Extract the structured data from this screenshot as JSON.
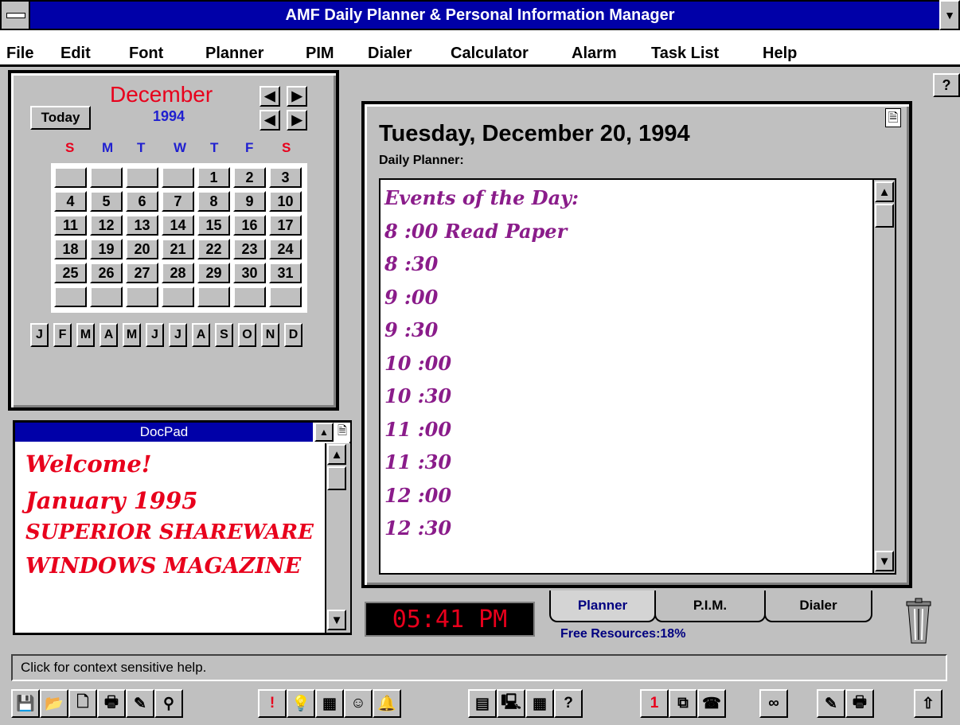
{
  "window": {
    "title": "AMF Daily Planner & Personal Information Manager"
  },
  "menu": [
    "File",
    "Edit",
    "Font",
    "Planner",
    "PIM",
    "Dialer",
    "Calculator",
    "Alarm",
    "Task List",
    "Help"
  ],
  "calendar": {
    "month": "December",
    "year": "1994",
    "today_label": "Today",
    "day_headers": [
      "S",
      "M",
      "T",
      "W",
      "T",
      "F",
      "S"
    ],
    "day_header_colors": [
      "#e8001c",
      "#2020d0",
      "#2020d0",
      "#2020d0",
      "#2020d0",
      "#2020d0",
      "#e8001c"
    ],
    "weeks": [
      [
        "",
        "",
        "",
        "",
        "1",
        "2",
        "3"
      ],
      [
        "4",
        "5",
        "6",
        "7",
        "8",
        "9",
        "10"
      ],
      [
        "11",
        "12",
        "13",
        "14",
        "15",
        "16",
        "17"
      ],
      [
        "18",
        "19",
        "20",
        "21",
        "22",
        "23",
        "24"
      ],
      [
        "25",
        "26",
        "27",
        "28",
        "29",
        "30",
        "31"
      ],
      [
        "",
        "",
        "",
        "",
        "",
        "",
        ""
      ]
    ],
    "month_buttons": [
      "J",
      "F",
      "M",
      "A",
      "M",
      "J",
      "J",
      "A",
      "S",
      "O",
      "N",
      "D"
    ]
  },
  "docpad": {
    "title": "DocPad",
    "lines": [
      "Welcome!",
      "January 1995",
      "SUPERIOR SHAREWARE",
      "WINDOWS MAGAZINE"
    ]
  },
  "planner": {
    "date_header": "Tuesday, December 20, 1994",
    "label": "Daily Planner:",
    "events": [
      "Events of the Day:",
      "8 :00 Read Paper",
      "8 :30",
      "9 :00",
      "9 :30",
      "10 :00",
      "10 :30",
      "11 :00",
      "11 :30",
      "12 :00",
      "12 :30"
    ]
  },
  "clock": "05:41 PM",
  "tabs": [
    "Planner",
    "P.I.M.",
    "Dialer"
  ],
  "free_resources": "Free Resources:18%",
  "status": "Click for context sensitive help.",
  "help_pointer": "?",
  "colors": {
    "title_bar": "#0000a8",
    "accent_red": "#e8001c",
    "event_purple": "#8a1c8a",
    "blue": "#2020d0"
  },
  "toolbar": [
    {
      "icon": "save-icon",
      "glyph": "💾"
    },
    {
      "icon": "open-folder-icon",
      "glyph": "📂"
    },
    {
      "icon": "new-document-icon",
      "glyph": "🗋"
    },
    {
      "icon": "print-icon",
      "glyph": "🖶"
    },
    {
      "icon": "edit-icon",
      "glyph": "✎"
    },
    {
      "icon": "search-icon",
      "glyph": "⚲"
    },
    {
      "icon": "alert-icon",
      "glyph": "!"
    },
    {
      "icon": "lightbulb-icon",
      "glyph": "💡"
    },
    {
      "icon": "calendar-icon",
      "glyph": "▦"
    },
    {
      "icon": "people-icon",
      "glyph": "☺"
    },
    {
      "icon": "alarm-bell-icon",
      "glyph": "🔔"
    },
    {
      "icon": "notepad-icon",
      "glyph": "▤"
    },
    {
      "icon": "computer-icon",
      "glyph": "🖳"
    },
    {
      "icon": "calculator-icon",
      "glyph": "▦"
    },
    {
      "icon": "question-icon",
      "glyph": "?"
    },
    {
      "icon": "daily-calendar-icon",
      "glyph": "1"
    },
    {
      "icon": "windows-icon",
      "glyph": "⧉"
    },
    {
      "icon": "phone-icon",
      "glyph": "☎"
    },
    {
      "icon": "glasses-icon",
      "glyph": "∞"
    },
    {
      "icon": "edit2-icon",
      "glyph": "✎"
    },
    {
      "icon": "print2-icon",
      "glyph": "🖶"
    },
    {
      "icon": "exit-door-icon",
      "glyph": "⇧"
    }
  ]
}
